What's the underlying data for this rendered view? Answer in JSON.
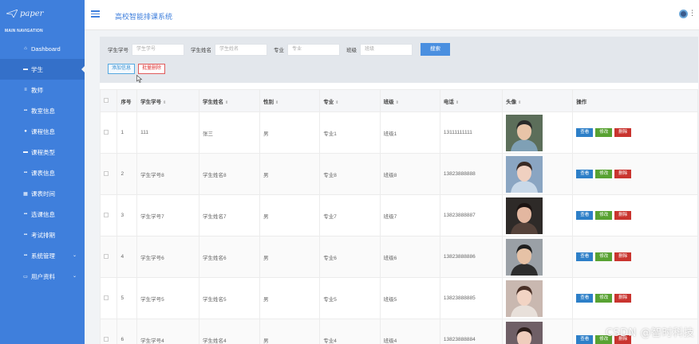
{
  "brand": {
    "name": "paper"
  },
  "app_title": "高校智能排课系统",
  "sidebar": {
    "heading": "MAIN NAVIGATION",
    "items": [
      {
        "label": "Dashboard",
        "icon": "home-icon"
      },
      {
        "label": "学生",
        "icon": "list-icon",
        "active": true
      },
      {
        "label": "教师",
        "icon": "menu-icon"
      },
      {
        "label": "教室信息",
        "icon": "grid-icon"
      },
      {
        "label": "课程信息",
        "icon": "pin-icon"
      },
      {
        "label": "课程类型",
        "icon": "list-icon"
      },
      {
        "label": "课表信息",
        "icon": "grid-icon"
      },
      {
        "label": "课表时间",
        "icon": "calendar-icon"
      },
      {
        "label": "选课信息",
        "icon": "grid-icon"
      },
      {
        "label": "考试排期",
        "icon": "grid-icon"
      },
      {
        "label": "系统管理",
        "icon": "grid-icon",
        "chevron": true
      },
      {
        "label": "用户资料",
        "icon": "user-card-icon",
        "chevron": true
      }
    ]
  },
  "filters": {
    "student_id_label": "学生学号",
    "student_id_placeholder": "学生学号",
    "student_name_label": "学生姓名",
    "student_name_placeholder": "学生姓名",
    "major_label": "专业",
    "major_placeholder": "专业",
    "class_label": "班级",
    "class_placeholder": "班级",
    "search_label": "搜索"
  },
  "actions": {
    "add_label": "添加信息",
    "bulk_delete_label": "批量删除"
  },
  "table": {
    "headers": [
      "序号",
      "学生学号",
      "学生姓名",
      "性别",
      "专业",
      "班级",
      "电话",
      "头像",
      "操作"
    ],
    "sortable": [
      "学生学号",
      "学生姓名",
      "性别",
      "专业",
      "班级",
      "电话",
      "头像"
    ],
    "rows": [
      {
        "idx": "1",
        "sid": "111",
        "name": "张三",
        "gender": "男",
        "major": "专业1",
        "cls": "班级1",
        "phone": "13111111111"
      },
      {
        "idx": "2",
        "sid": "学生学号8",
        "name": "学生姓名8",
        "gender": "男",
        "major": "专业8",
        "cls": "班级8",
        "phone": "13823888888"
      },
      {
        "idx": "3",
        "sid": "学生学号7",
        "name": "学生姓名7",
        "gender": "男",
        "major": "专业7",
        "cls": "班级7",
        "phone": "13823888887"
      },
      {
        "idx": "4",
        "sid": "学生学号6",
        "name": "学生姓名6",
        "gender": "男",
        "major": "专业6",
        "cls": "班级6",
        "phone": "13823888886"
      },
      {
        "idx": "5",
        "sid": "学生学号5",
        "name": "学生姓名5",
        "gender": "男",
        "major": "专业5",
        "cls": "班级5",
        "phone": "13823888885"
      },
      {
        "idx": "6",
        "sid": "学生学号4",
        "name": "学生姓名4",
        "gender": "男",
        "major": "专业4",
        "cls": "班级4",
        "phone": "13823888884"
      }
    ],
    "op_labels": {
      "view": "查看",
      "edit": "修改",
      "del": "删除"
    }
  },
  "watermark": "CSDN @智时科技",
  "colors": {
    "sidebar": "#3f7fdc",
    "view": "#2d7fc8",
    "edit": "#58a232",
    "del": "#c9342f"
  }
}
